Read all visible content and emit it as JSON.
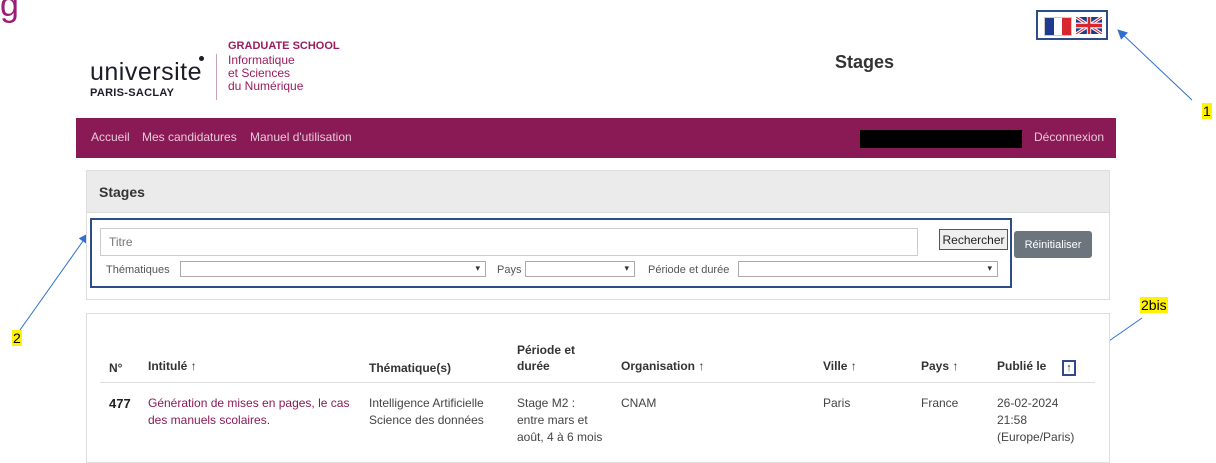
{
  "corner_letter": "g",
  "header": {
    "logo": {
      "word": "universite",
      "sub": "PARIS-SACLAY",
      "graduate_school": "GRADUATE SCHOOL",
      "lines": [
        "Informatique",
        "et Sciences",
        "du Numérique"
      ]
    },
    "page_title": "Stages"
  },
  "nav": {
    "items": [
      "Accueil",
      "Mes candidatures",
      "Manuel d'utilisation"
    ],
    "logout": "Déconnexion"
  },
  "panel": {
    "title": "Stages",
    "search_placeholder": "Titre",
    "search_button": "Rechercher",
    "reset_button": "Réinitialiser",
    "filters": {
      "thematiques": "Thématiques",
      "pays": "Pays",
      "periode": "Période et durée"
    }
  },
  "annotations": {
    "a1": "1",
    "a2": "2",
    "a2bis": "2bis"
  },
  "table": {
    "headers": {
      "num": "N°",
      "intitule": "Intitulé ↑",
      "thematiques": "Thématique(s)",
      "periode_1": "Période et",
      "periode_2": "durée",
      "organisation": "Organisation ↑",
      "ville": "Ville ↑",
      "pays": "Pays ↑",
      "publie": "Publié le",
      "sort_arrow": "↑"
    },
    "row": {
      "num": "477",
      "intitule_1": "Génération de mises en pages, le cas",
      "intitule_2": "des manuels scolaires.",
      "them_1": "Intelligence Artificielle",
      "them_2": "Science des données",
      "per_1": "Stage M2 :",
      "per_2": "entre mars et",
      "per_3": "août, 4 à 6 mois",
      "organisation": "CNAM",
      "ville": "Paris",
      "pays": "France",
      "date_1": "26-02-2024",
      "date_2": "21:58",
      "date_3": "(Europe/Paris)"
    }
  },
  "colors": {
    "brand": "#8a1a56",
    "annotation_blue": "#2e4c8a",
    "highlight": "#fff200"
  }
}
